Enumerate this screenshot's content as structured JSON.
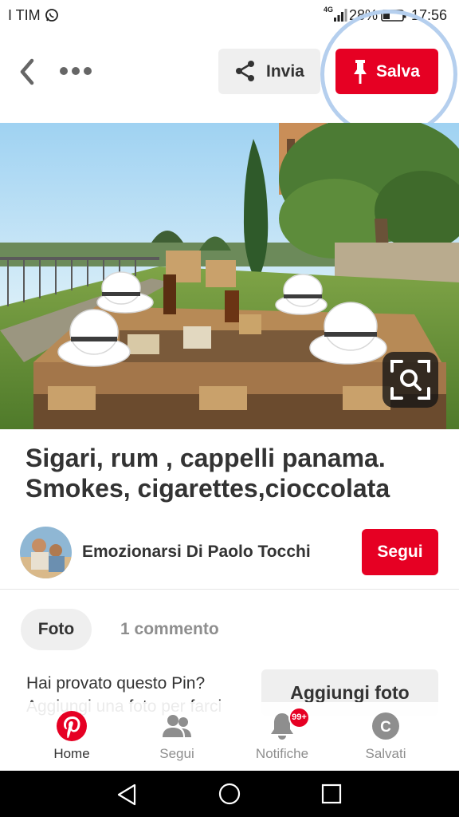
{
  "status_bar": {
    "carrier": "I TIM",
    "network": "4G",
    "battery_percent": "28%",
    "time": "17:56"
  },
  "header": {
    "back_icon": "chevron-left-icon",
    "more_icon": "more-dots-icon",
    "share_label": "Invia",
    "save_label": "Salva"
  },
  "pin": {
    "image_description_icon": "visual-search-icon",
    "title": "Sigari, rum , cappelli panama. Smokes, cigarettes,cioccolata"
  },
  "creator": {
    "name": "Emozionarsi Di Paolo Tocchi",
    "follow_label": "Segui"
  },
  "tabs": [
    {
      "label": "Foto",
      "active": true
    },
    {
      "label": "1 commento",
      "active": false
    }
  ],
  "try_section": {
    "question": "Hai provato questo Pin?",
    "subtitle": "Aggiungi una foto per farci",
    "add_photo_label": "Aggiungi foto"
  },
  "bottom_nav": {
    "items": [
      {
        "label": "Home",
        "icon": "pinterest-logo-icon",
        "active": true
      },
      {
        "label": "Segui",
        "icon": "people-icon",
        "active": false
      },
      {
        "label": "Notifiche",
        "icon": "bell-icon",
        "active": false,
        "badge": "99+"
      },
      {
        "label": "Salvati",
        "icon": "profile-initial-icon",
        "initial": "C",
        "active": false
      }
    ]
  },
  "colors": {
    "brand_red": "#e60023",
    "light_gray": "#efefef",
    "text_dark": "#333333",
    "text_muted": "#8e8e8e",
    "highlight_ring": "#b5cfee"
  }
}
